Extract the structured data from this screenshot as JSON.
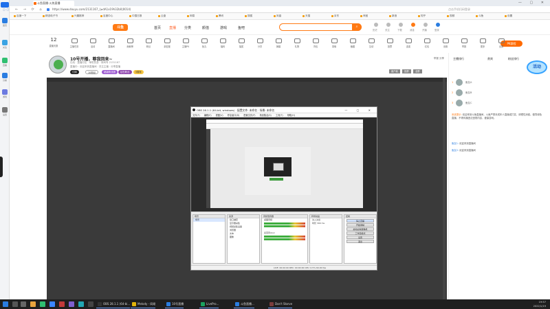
{
  "browser": {
    "tab_title": "斗鱼直播-火热直播",
    "url": "https://www.douyu.com/2131167_(≥dA1x19h32b0|0014)",
    "address_hint": "点击手机扫码登录",
    "window_controls": "— ▢ ✕",
    "nav_glyphs": "← → ⟳ ⌂",
    "bookmarks": [
      "百度一下",
      "精选电子书",
      "兴趣推荐",
      "百度中心",
      "中国日报",
      "云盘",
      "网易",
      "腾讯",
      "搜狐",
      "凤凰",
      "天猫",
      "京东",
      "淘宝",
      "新浪",
      "知乎",
      "视频",
      "斗鱼",
      "设置"
    ]
  },
  "watermark": "DOUYU.COM",
  "dock": {
    "items": [
      "首页",
      "关注",
      "直播",
      "分类",
      "游戏",
      "设置"
    ]
  },
  "site_header": {
    "logo": "斗鱼",
    "nav": [
      "首页",
      "直播",
      "分类",
      "颜值",
      "游戏",
      "鱼吧"
    ],
    "active_index": 1,
    "search_icon": "⌕",
    "right_items": [
      "历史",
      "关注",
      "下载",
      "消息",
      "开播",
      "登录"
    ]
  },
  "tools": {
    "count": "12",
    "count_label": "直播天数",
    "labels": [
      "主播任务",
      "活动",
      "直播间",
      "贡献榜",
      "粉丝",
      "亲密度",
      "主播PK",
      "鱼丸",
      "福利",
      "抽奖",
      "分享",
      "弹幕",
      "礼物",
      "背包",
      "录像",
      "截图",
      "互动",
      "投票",
      "连麦",
      "红包",
      "设置",
      "举报",
      "更多",
      "全屏"
    ],
    "pk_button": "PK赛程"
  },
  "room": {
    "title": "10号开播，尊我回来~",
    "meta": "在线 · 直播分区 · 单机热游 · 房间号 2131167",
    "meta2": "直播中：欢迎来到直播间   ·  关注主播  ·  分享直播",
    "badges": [
      "订阅",
      "10粉丝",
      "超级粉丝团",
      "钻石粉丝",
      "5周年"
    ],
    "side": "举报   分享",
    "buttons": [
      "客户端",
      "投屏",
      "全屏"
    ]
  },
  "obs": {
    "title": "OBS 28.1.1 (64-bit, windows) · 配置文件: 未命名 · 场景: 未命名",
    "menu": [
      "文件(F)",
      "编辑(E)",
      "视图(V)",
      "停靠窗口(D)",
      "配置文件(P)",
      "场景集合(S)",
      "工具(T)",
      "帮助(H)"
    ],
    "docks": {
      "scenes": {
        "title": "场景",
        "items": [
          "场景"
        ]
      },
      "sources": {
        "title": "来源",
        "items": [
          "窗口捕获",
          "显示器采集",
          "视频采集设备",
          "浏览器",
          "文本",
          "图像"
        ]
      },
      "mixer": {
        "title": "音频混音器",
        "items": [
          "桌面音频",
          "麦克风/Aux"
        ]
      },
      "transitions": {
        "title": "转场动画",
        "items": [
          "淡入淡出",
          "时长 300 ms"
        ]
      },
      "controls": {
        "title": "控制",
        "items": [
          "停止直播",
          "开始录制",
          "启动虚拟摄像机",
          "工作室模式",
          "设置",
          "退出"
        ],
        "highlight_index": 0
      }
    },
    "status": "LIVE: 00:00:00   REC: 00:00:00   CPU: 0.5%   60.00 fps"
  },
  "chat": {
    "tabs": [
      "主播排行",
      "贵宾",
      "粉丝排行"
    ],
    "ranks": [
      {
        "pos": "1",
        "name": "鱼友A"
      },
      {
        "pos": "2",
        "name": "鱼友B"
      },
      {
        "pos": "3",
        "name": "鱼友C"
      }
    ],
    "messages": [
      {
        "nick": "系统提示:",
        "text": "欢迎来到斗鱼直播间，斗鱼严禁未成年人直播或打赏，请理性消费。倡导绿色直播，不得传播违法违规内容，健康游戏。"
      },
      {
        "nick": "鱼友1:",
        "text": "欢迎来到直播间"
      },
      {
        "nick": "鱼友2:",
        "text": "欢迎来到直播间"
      }
    ],
    "promo": "活动"
  },
  "taskbar": {
    "tasks": [
      {
        "label": "OBS 28.1.1 (64-bi...",
        "color": "#333333"
      },
      {
        "label": "Melody - 网易",
        "color": "#e2b40a"
      },
      {
        "label": "10号直播",
        "color": "#2a7de1"
      },
      {
        "label": "LivePro...",
        "color": "#1aa260"
      },
      {
        "label": "斗鱼直播...",
        "color": "#2a7de1"
      },
      {
        "label": "Don't Starve",
        "color": "#7a3d3d"
      }
    ],
    "time": "19:57",
    "date": "2022/1/19"
  },
  "colors": {
    "brand_orange": "#ff7a14",
    "player_bg": "#3a3a3a",
    "taskbar": "#1f1f1f"
  }
}
